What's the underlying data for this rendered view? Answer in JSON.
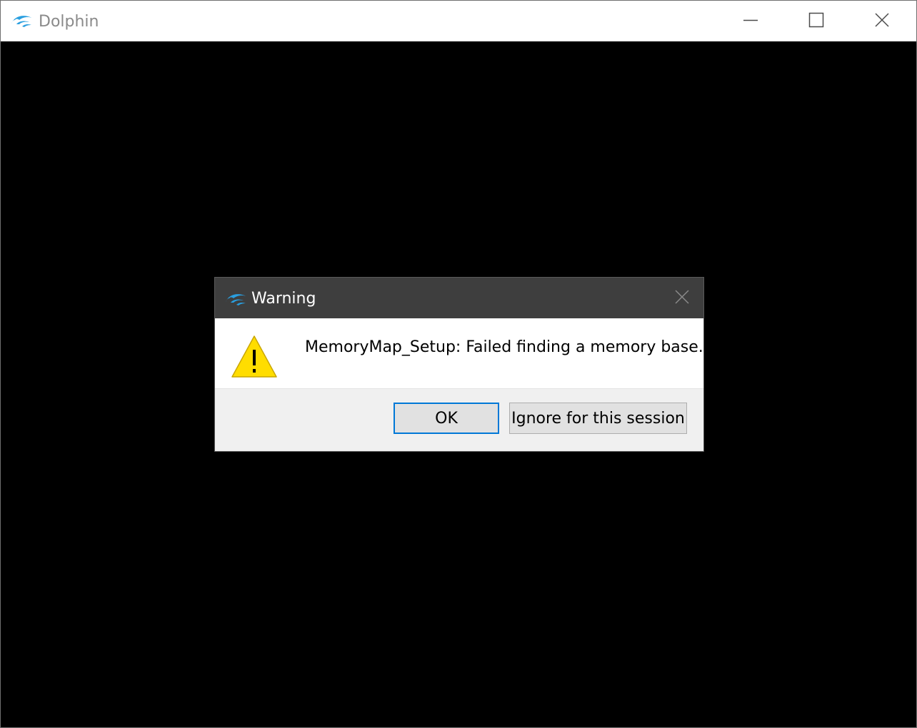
{
  "window": {
    "title": "Dolphin",
    "logo_icon": "dolphin-logo-icon",
    "controls": {
      "minimize_icon": "minimize-icon",
      "maximize_icon": "maximize-icon",
      "close_icon": "close-icon"
    }
  },
  "dialog": {
    "title": "Warning",
    "logo_icon": "dolphin-logo-icon",
    "close_icon": "close-icon",
    "severity_icon": "warning-icon",
    "message": "MemoryMap_Setup: Failed finding a memory base.",
    "buttons": {
      "ok_label": "OK",
      "ignore_label": "Ignore for this session"
    }
  },
  "colors": {
    "accent": "#0078d7",
    "dolphin_blue": "#2a9fe0",
    "dialog_titlebar": "#3e3e3e",
    "warning_yellow": "#ffdd00"
  }
}
